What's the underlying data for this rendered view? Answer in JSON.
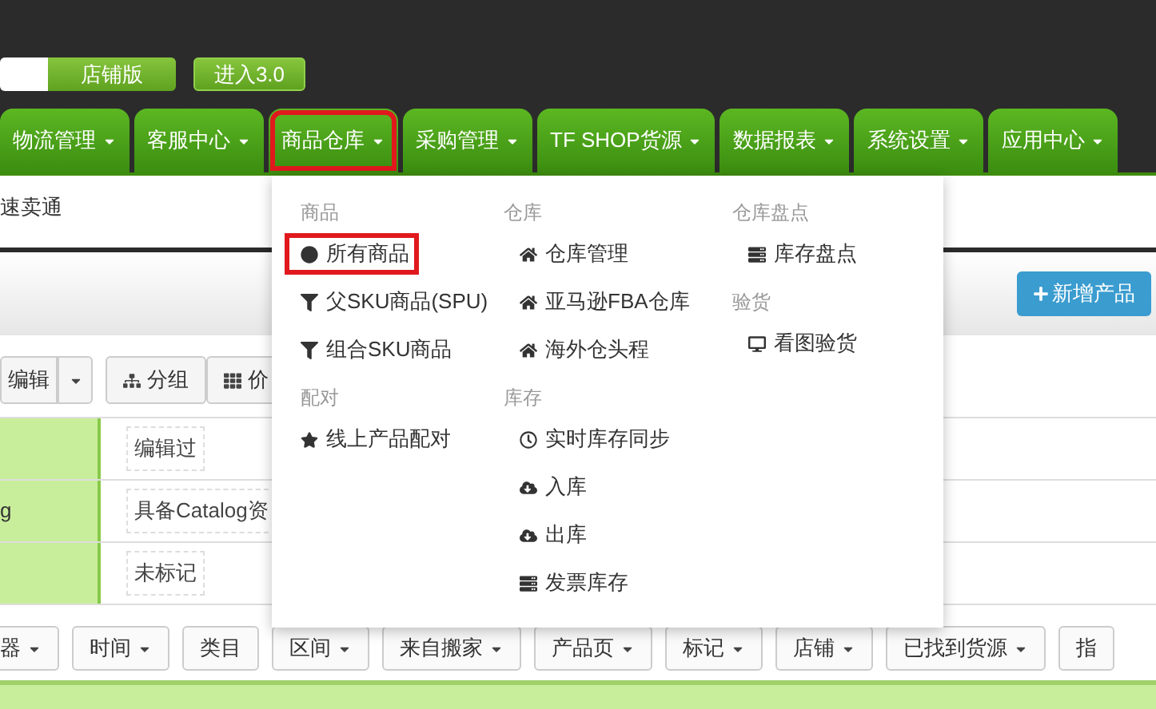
{
  "top_bar": {
    "edition_button": "店铺版",
    "enter_button": "进入3.0"
  },
  "nav": [
    {
      "label": "物流管理",
      "selected": false
    },
    {
      "label": "客服中心",
      "selected": false
    },
    {
      "label": "商品仓库",
      "selected": true
    },
    {
      "label": "采购管理",
      "selected": false
    },
    {
      "label": "TF SHOP货源",
      "selected": false
    },
    {
      "label": "数据报表",
      "selected": false
    },
    {
      "label": "系统设置",
      "selected": false
    },
    {
      "label": "应用中心",
      "selected": false
    }
  ],
  "dropdown": {
    "columns": [
      {
        "sections": [
          {
            "title": "商品",
            "items": [
              {
                "label": "所有商品",
                "kind": "dot",
                "selected": true
              },
              {
                "label": "父SKU商品(SPU)",
                "kind": "filter",
                "selected": false
              },
              {
                "label": "组合SKU商品",
                "kind": "filter",
                "selected": false
              }
            ]
          },
          {
            "title": "配对",
            "items": [
              {
                "label": "线上产品配对",
                "kind": "star",
                "selected": false
              }
            ]
          }
        ]
      },
      {
        "sections": [
          {
            "title": "仓库",
            "items": [
              {
                "label": "仓库管理",
                "kind": "home",
                "selected": false
              },
              {
                "label": "亚马逊FBA仓库",
                "kind": "home",
                "selected": false
              },
              {
                "label": "海外仓头程",
                "kind": "home",
                "selected": false
              }
            ]
          },
          {
            "title": "库存",
            "items": [
              {
                "label": "实时库存同步",
                "kind": "clock",
                "selected": false
              },
              {
                "label": "入库",
                "kind": "cloud",
                "selected": false
              },
              {
                "label": "出库",
                "kind": "cloud",
                "selected": false
              },
              {
                "label": "发票库存",
                "kind": "bars",
                "selected": false
              }
            ]
          }
        ]
      },
      {
        "sections": [
          {
            "title": "仓库盘点",
            "items": [
              {
                "label": "库存盘点",
                "kind": "bars",
                "selected": false
              }
            ]
          },
          {
            "title": "验货",
            "items": [
              {
                "label": "看图验货",
                "kind": "monitor",
                "selected": false
              }
            ]
          }
        ]
      }
    ]
  },
  "page": {
    "breadcrumb": "速卖通",
    "add_button": "新增产品",
    "toolbar": [
      {
        "label": "编辑",
        "kind": "split"
      },
      {
        "label": "分组",
        "kind": "group"
      },
      {
        "label": "价",
        "kind": "table"
      }
    ],
    "tag_rows": [
      {
        "tag": "编辑过"
      },
      {
        "left": "g",
        "tag": "具备Catalog资"
      },
      {
        "tag": "未标记"
      }
    ],
    "filters": [
      {
        "label": "器",
        "caret": true
      },
      {
        "label": "时间",
        "caret": true
      },
      {
        "label": "类目",
        "caret": false
      },
      {
        "label": "区间",
        "caret": true
      },
      {
        "label": "来自搬家",
        "caret": true
      },
      {
        "label": "产品页",
        "caret": true
      },
      {
        "label": "标记",
        "caret": true
      },
      {
        "label": "店铺",
        "caret": true
      },
      {
        "label": "已找到货源",
        "caret": true
      },
      {
        "label": "指",
        "caret": false
      }
    ]
  }
}
